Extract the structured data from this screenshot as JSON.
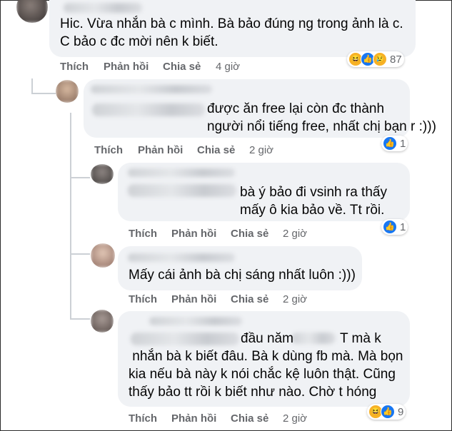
{
  "comments": [
    {
      "text": "Hic. Vừa nhắn bà c mình. Bà bảo đúng ng trong ảnh là c.\nC bảo c đc mời nên k biết.",
      "reactions": [
        "haha",
        "like",
        "sad"
      ],
      "count": "87",
      "time": "4 giờ"
    },
    {
      "text": "được ăn free lại còn đc thành\nngười nổi tiếng free, nhất chị bạn r :)))",
      "reactions": [
        "like"
      ],
      "count": "1",
      "time": "2 giờ"
    },
    {
      "text": "bà ý bảo đi vsinh ra thấy\nmấy ô kia bảo về. Tt rồi.",
      "reactions": [
        "like"
      ],
      "count": "1",
      "time": "2 giờ"
    },
    {
      "text": "Mấy cái ảnh bà chị sáng nhất luôn :)))",
      "reactions": [],
      "count": "",
      "time": "2 giờ"
    },
    {
      "text": "đầu năm\n nhắn bà k biết đâu. Bà k dùng fb mà. Mà bọn\nkia nếu bà này k nói chắc kệ luôn thật. Cũng\nthấy bảo tt rồi k biết như nào. Chờ t hóng",
      "text_tail": "T mà k",
      "reactions": [
        "haha",
        "like"
      ],
      "count": "9",
      "time": "2 giờ"
    }
  ],
  "actions": {
    "like": "Thích",
    "reply": "Phản hồi",
    "share": "Chia sẻ"
  },
  "colors": {
    "bubble": "#f0f2f5",
    "action_text": "#65676b",
    "like_blue": "#1877f2",
    "haha_yellow": "#f7b125"
  }
}
